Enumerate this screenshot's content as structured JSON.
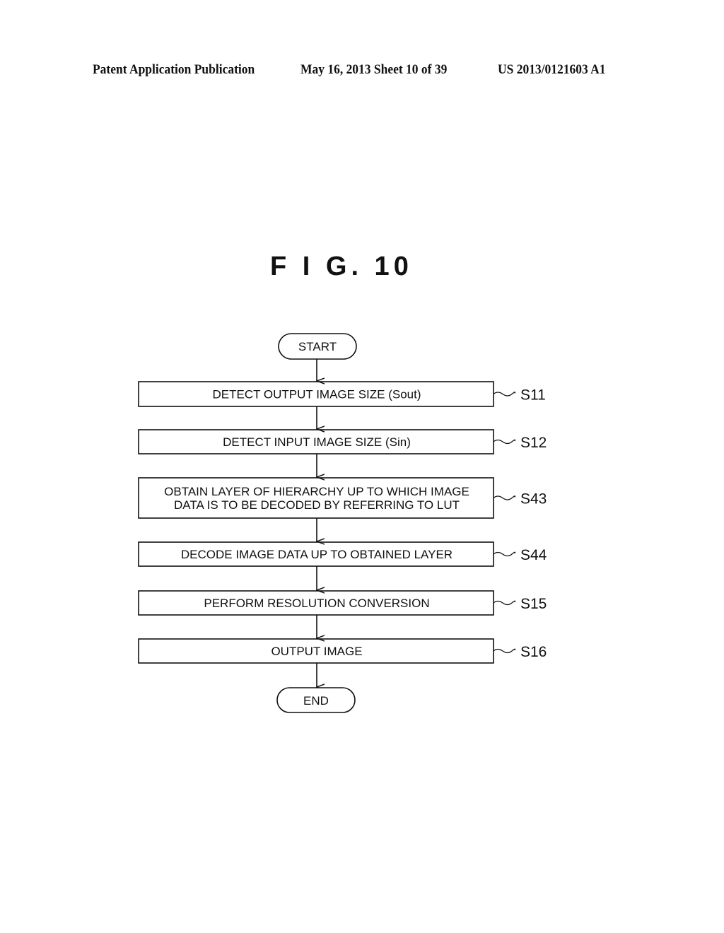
{
  "header": {
    "left": "Patent Application Publication",
    "middle": "May 16, 2013  Sheet 10 of 39",
    "right": "US 2013/0121603 A1"
  },
  "figure": {
    "title": "F I G. 10"
  },
  "flowchart": {
    "start": "START",
    "end": "END",
    "steps": [
      {
        "id": "S11",
        "lines": [
          "DETECT OUTPUT IMAGE SIZE (Sout)"
        ]
      },
      {
        "id": "S12",
        "lines": [
          "DETECT INPUT IMAGE SIZE (Sin)"
        ]
      },
      {
        "id": "S43",
        "lines": [
          "OBTAIN LAYER OF HIERARCHY UP TO WHICH IMAGE",
          "DATA IS TO BE DECODED BY REFERRING TO LUT"
        ]
      },
      {
        "id": "S44",
        "lines": [
          "DECODE IMAGE DATA UP TO OBTAINED LAYER"
        ]
      },
      {
        "id": "S15",
        "lines": [
          "PERFORM RESOLUTION CONVERSION"
        ]
      },
      {
        "id": "S16",
        "lines": [
          "OUTPUT IMAGE"
        ]
      }
    ]
  }
}
